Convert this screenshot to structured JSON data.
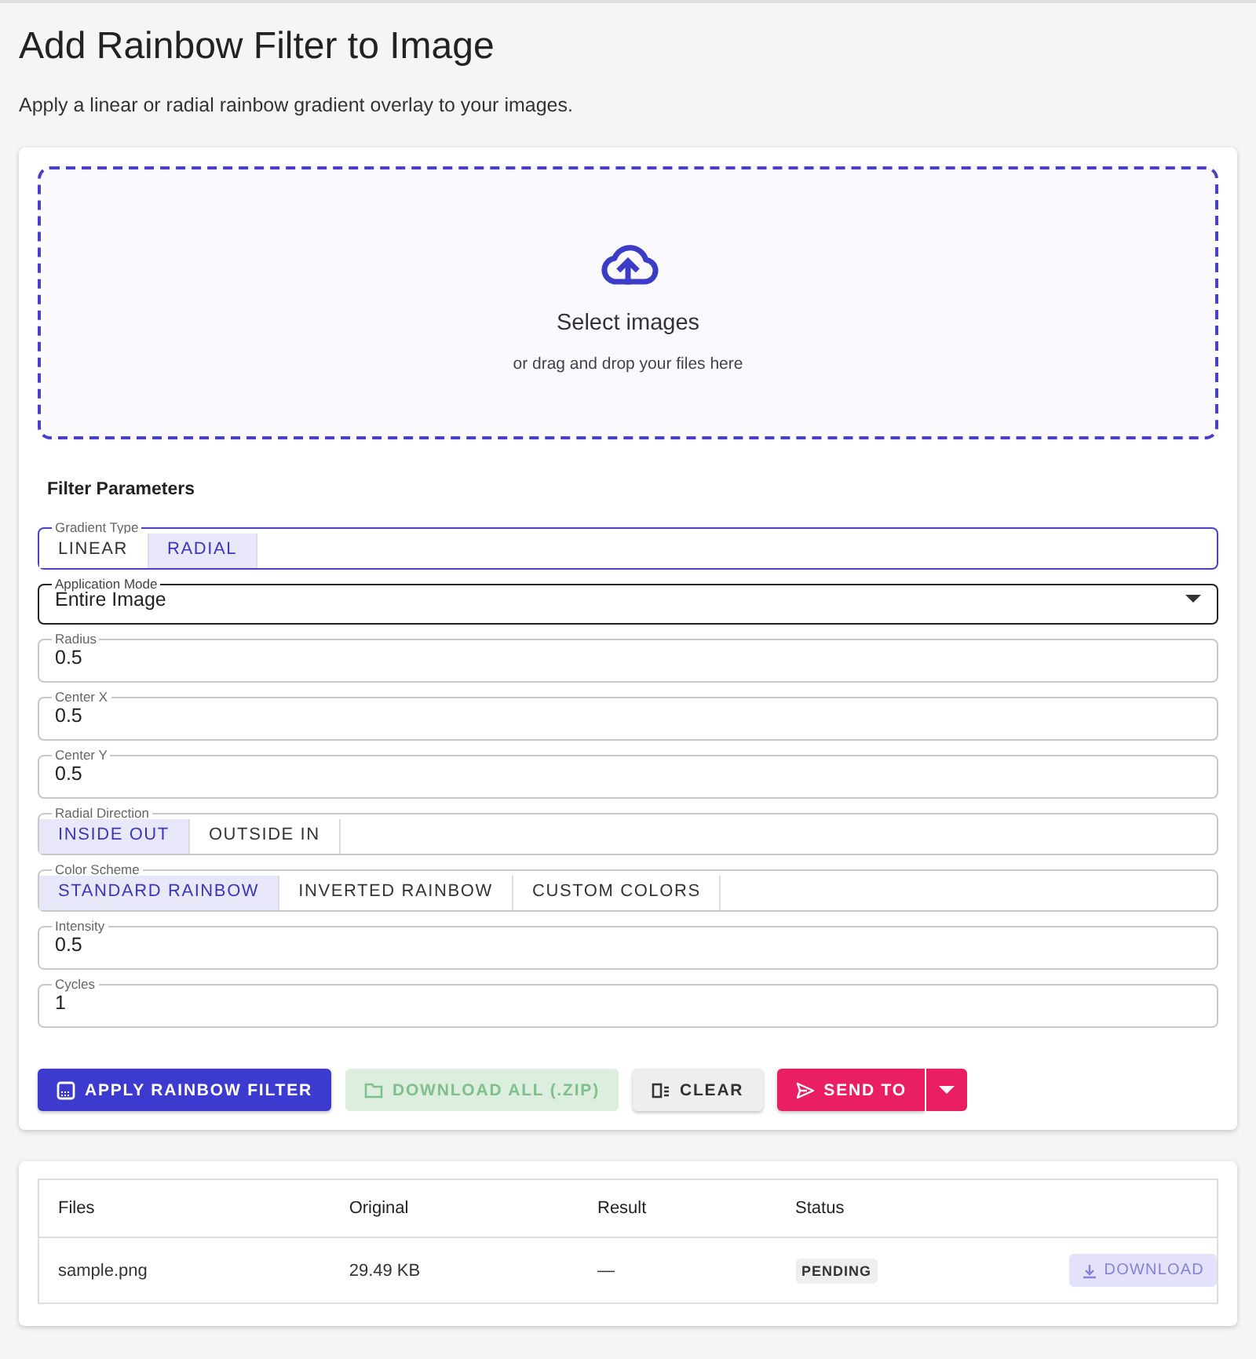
{
  "page": {
    "title": "Add Rainbow Filter to Image",
    "subtitle": "Apply a linear or radial rainbow gradient overlay to your images."
  },
  "dropzone": {
    "title": "Select images",
    "hint": "or drag and drop your files here"
  },
  "parameters": {
    "heading": "Filter Parameters",
    "fields": [
      {
        "kind": "toggle",
        "label": "Gradient Type",
        "focused": true,
        "hovered": false,
        "options": [
          {
            "label": "LINEAR",
            "selected": false
          },
          {
            "label": "RADIAL",
            "selected": true
          }
        ]
      },
      {
        "kind": "select",
        "label": "Application Mode",
        "focused": false,
        "hovered": true,
        "value": "Entire Image"
      },
      {
        "kind": "text",
        "label": "Radius",
        "focused": false,
        "hovered": false,
        "value": "0.5"
      },
      {
        "kind": "text",
        "label": "Center X",
        "focused": false,
        "hovered": false,
        "value": "0.5"
      },
      {
        "kind": "text",
        "label": "Center Y",
        "focused": false,
        "hovered": false,
        "value": "0.5"
      },
      {
        "kind": "toggle",
        "label": "Radial Direction",
        "focused": false,
        "hovered": false,
        "options": [
          {
            "label": "INSIDE OUT",
            "selected": true
          },
          {
            "label": "OUTSIDE IN",
            "selected": false
          }
        ]
      },
      {
        "kind": "toggle",
        "label": "Color Scheme",
        "focused": false,
        "hovered": false,
        "options": [
          {
            "label": "STANDARD RAINBOW",
            "selected": true
          },
          {
            "label": "INVERTED RAINBOW",
            "selected": false
          },
          {
            "label": "CUSTOM COLORS",
            "selected": false
          }
        ]
      },
      {
        "kind": "text",
        "label": "Intensity",
        "focused": false,
        "hovered": false,
        "value": "0.5"
      },
      {
        "kind": "text",
        "label": "Cycles",
        "focused": false,
        "hovered": false,
        "value": "1"
      }
    ]
  },
  "actions": [
    {
      "kind": "apply",
      "label": "APPLY RAINBOW FILTER",
      "disabled": false
    },
    {
      "kind": "download",
      "label": "DOWNLOAD ALL (.ZIP)",
      "disabled": true
    },
    {
      "kind": "clear",
      "label": "CLEAR",
      "disabled": false
    },
    {
      "kind": "send",
      "label": "SEND TO",
      "disabled": false
    }
  ],
  "table": {
    "columns": [
      "Files",
      "Original",
      "Result",
      "Status"
    ],
    "rows": [
      {
        "file": "sample.png",
        "original": "29.49 KB",
        "result": "—",
        "status": "PENDING",
        "action": {
          "label": "DOWNLOAD",
          "disabled": true
        }
      }
    ]
  }
}
